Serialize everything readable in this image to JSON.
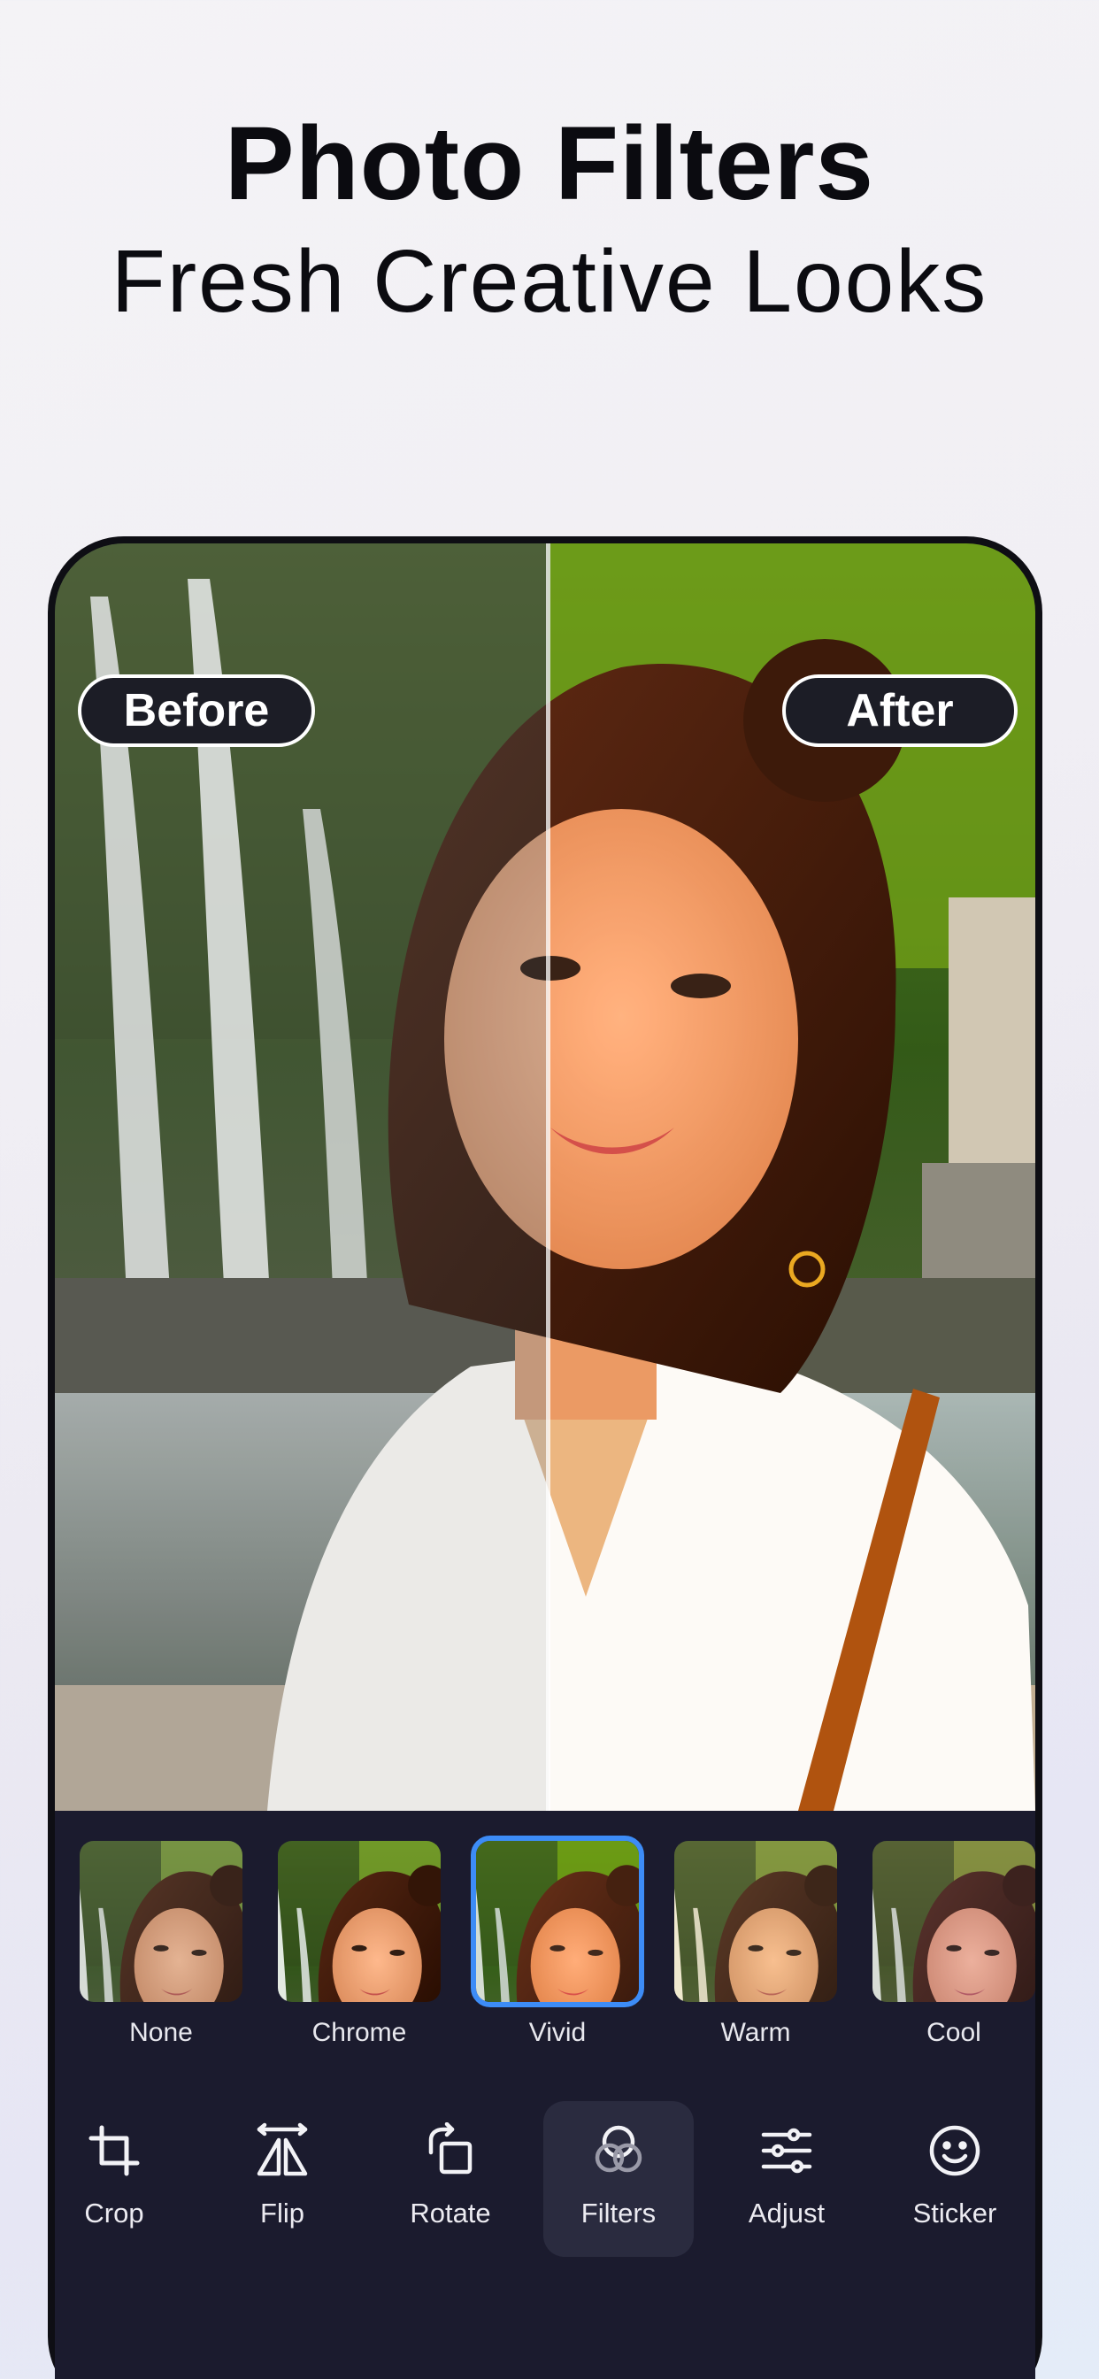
{
  "header": {
    "title": "Photo Filters",
    "subtitle": "Fresh Creative Looks"
  },
  "compare": {
    "before_label": "Before",
    "after_label": "After"
  },
  "filters": [
    {
      "label": "None",
      "selected": false
    },
    {
      "label": "Chrome",
      "selected": false
    },
    {
      "label": "Vivid",
      "selected": true
    },
    {
      "label": "Warm",
      "selected": false
    },
    {
      "label": "Cool",
      "selected": false
    }
  ],
  "toolbar": {
    "tools": [
      {
        "label": "Crop",
        "icon": "crop-icon"
      },
      {
        "label": "Flip",
        "icon": "flip-icon"
      },
      {
        "label": "Rotate",
        "icon": "rotate-icon"
      },
      {
        "label": "Filters",
        "icon": "filters-icon",
        "active": true
      },
      {
        "label": "Adjust",
        "icon": "adjust-icon"
      },
      {
        "label": "Sticker",
        "icon": "sticker-icon"
      }
    ]
  },
  "colors": {
    "accent": "#3d8cf6",
    "panel": "#1b1b2e",
    "frame": "#0e0e14"
  }
}
